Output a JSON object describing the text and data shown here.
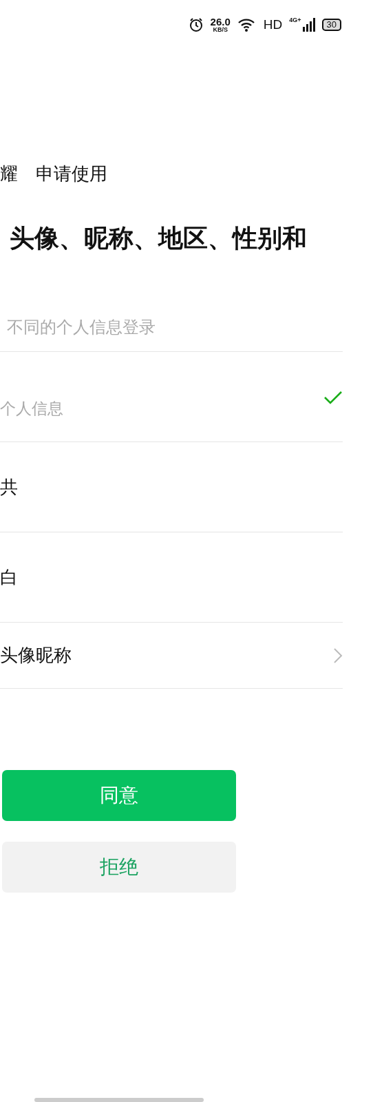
{
  "status_bar": {
    "speed": "26.0",
    "speed_unit": "KB/S",
    "hd": "HD",
    "network": "4G+",
    "battery": "30"
  },
  "header": {
    "app_fragment": "耀",
    "request": "申请使用"
  },
  "title": "头像、昵称、地区、性别和",
  "subtitle": "不同的个人信息登录",
  "options": [
    {
      "kind": "option",
      "label": "个人信息",
      "muted": true,
      "selected": true
    },
    {
      "kind": "option",
      "label": "共",
      "muted": false,
      "selected": false
    },
    {
      "kind": "option",
      "label": "白",
      "muted": false,
      "selected": false
    },
    {
      "kind": "link",
      "label": "头像昵称",
      "muted": false
    }
  ],
  "buttons": [
    {
      "kind": "primary",
      "label": "同意"
    },
    {
      "kind": "secondary",
      "label": "拒绝"
    }
  ]
}
